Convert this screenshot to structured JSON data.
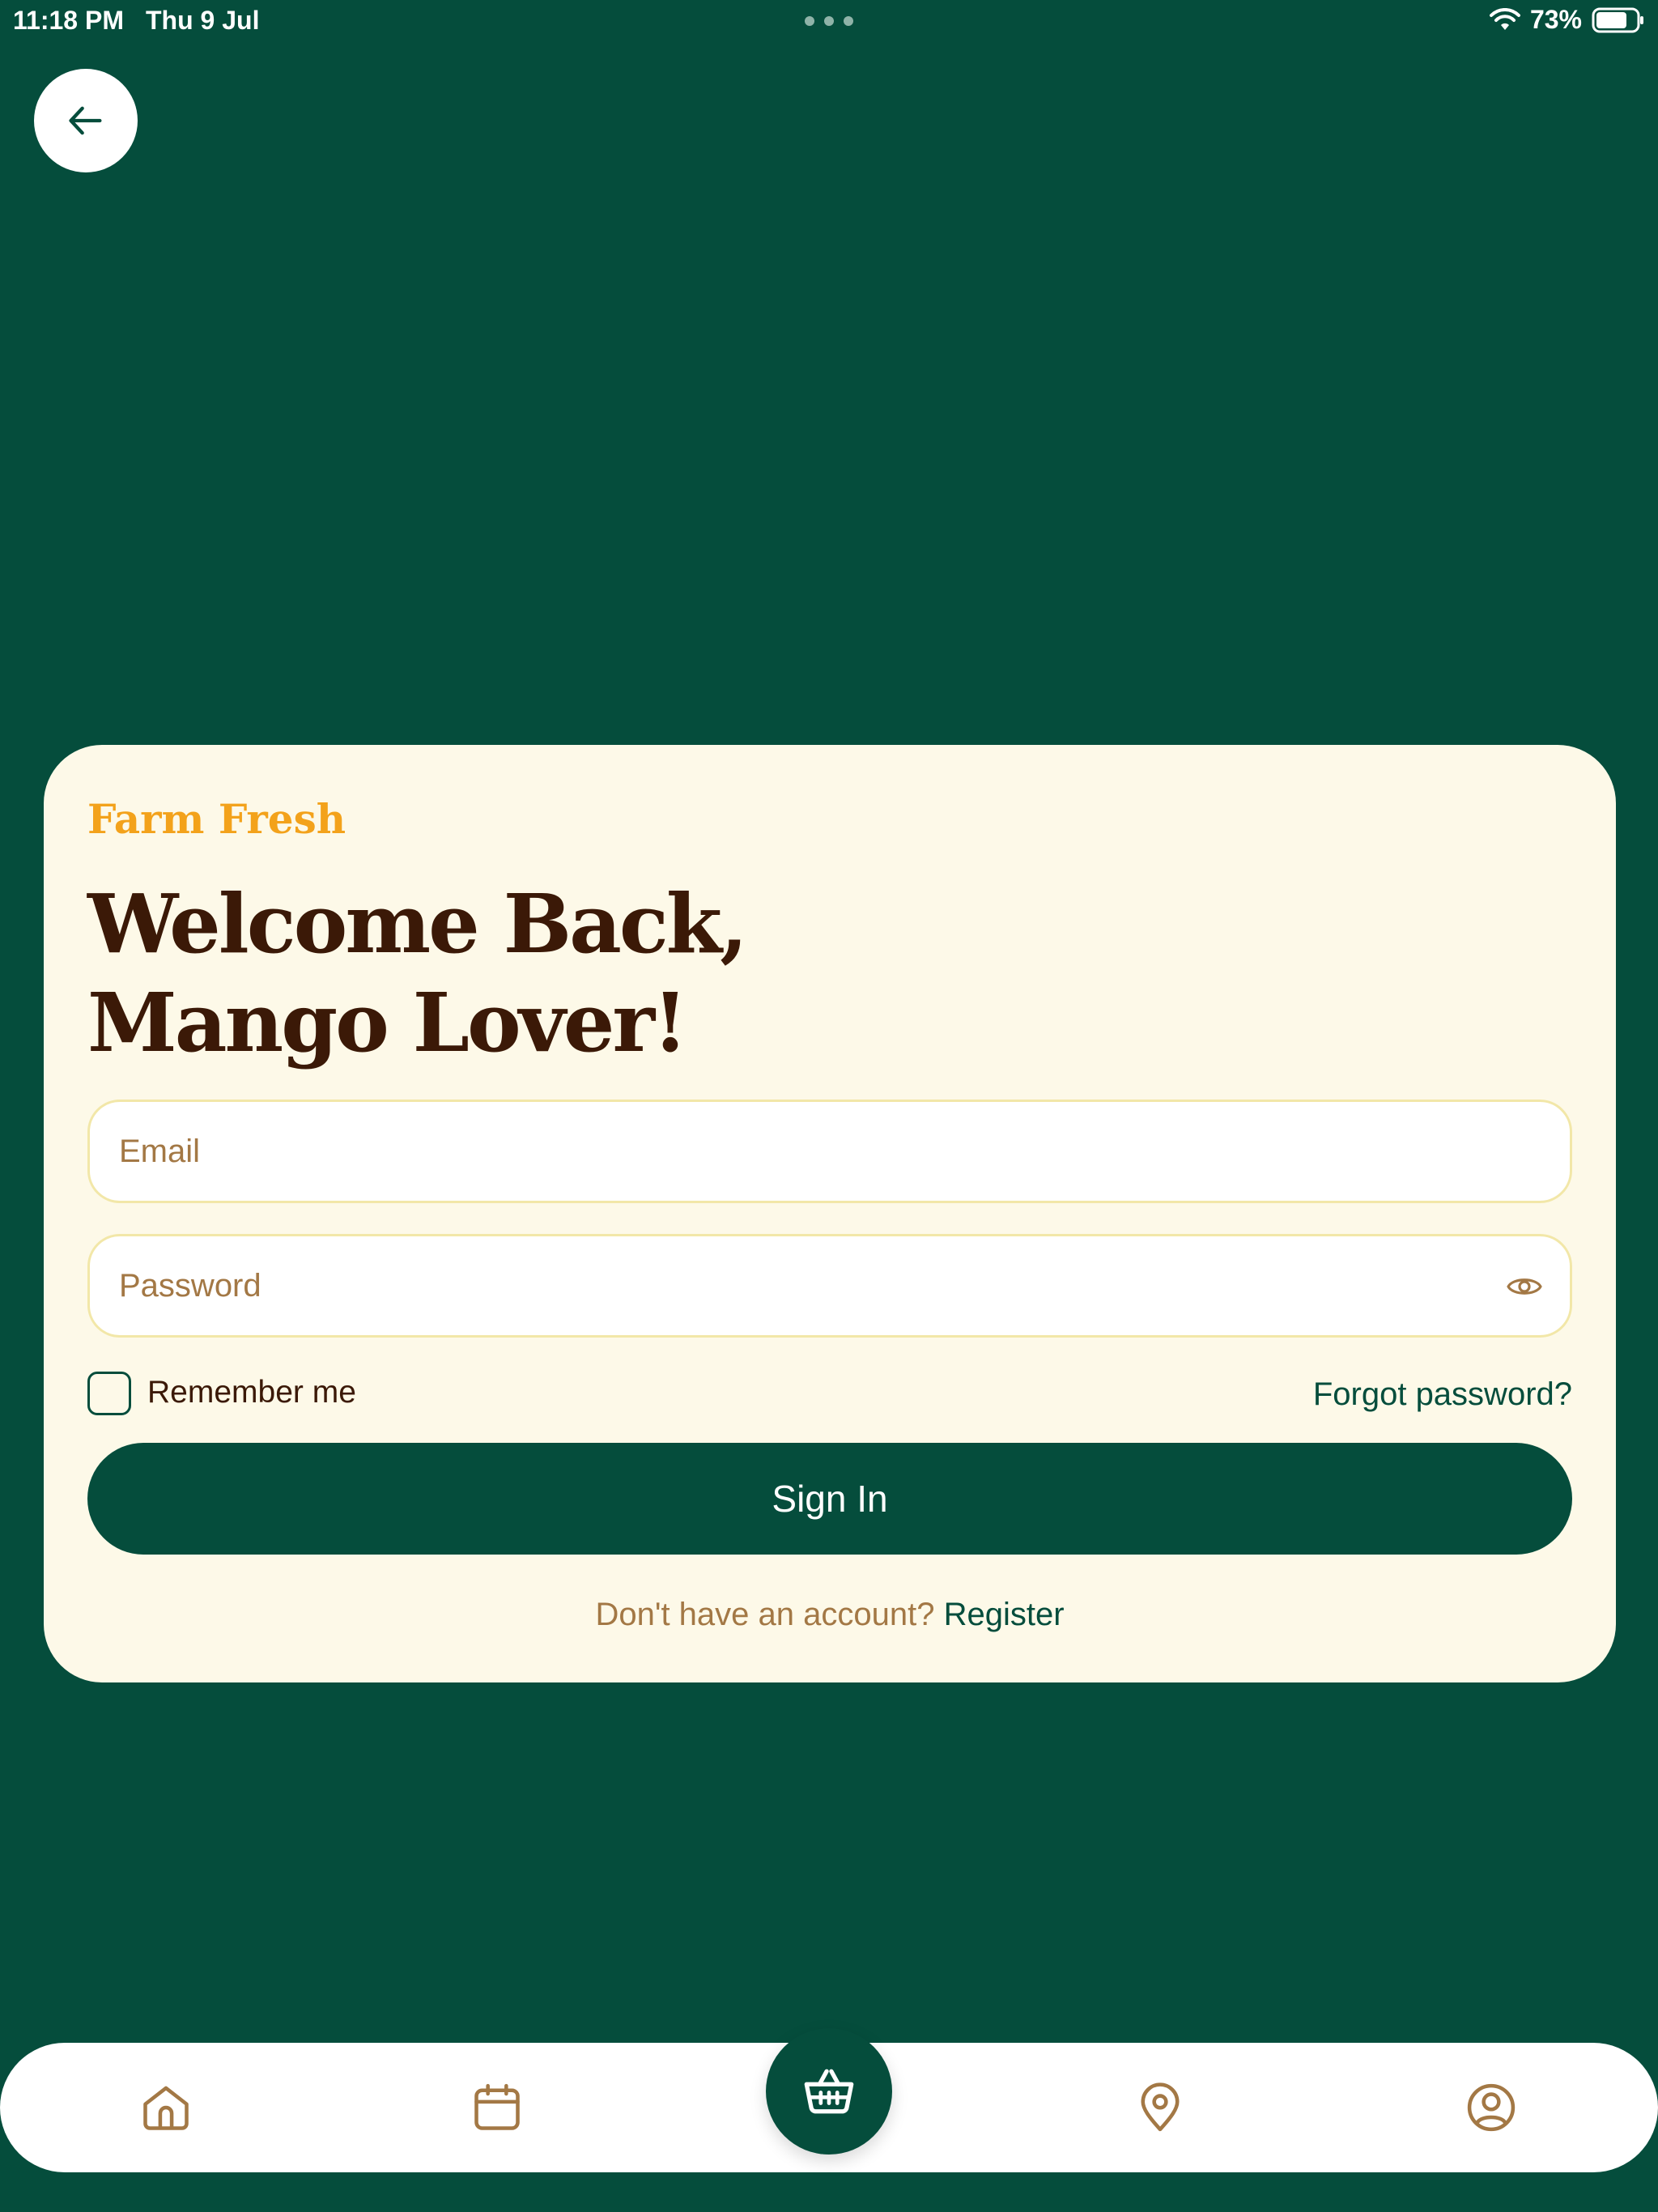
{
  "status_bar": {
    "time": "11:18 PM",
    "date": "Thu 9 Jul",
    "battery": "73%"
  },
  "login_card": {
    "brand": "Farm Fresh",
    "welcome_line1": "Welcome Back,",
    "welcome_line2": "Mango Lover!",
    "email_placeholder": "Email",
    "password_placeholder": "Password",
    "remember_label": "Remember me",
    "forgot_label": "Forgot password?",
    "signin_label": "Sign In",
    "register_prompt": "Don't have an account? ",
    "register_label": "Register"
  },
  "bottom_nav": {
    "items": [
      {
        "icon": "home-icon"
      },
      {
        "icon": "calendar-icon"
      },
      {
        "icon": "basket-icon"
      },
      {
        "icon": "location-pin-icon"
      },
      {
        "icon": "profile-icon"
      }
    ]
  },
  "colors": {
    "background": "#054d3c",
    "card": "#fdf9e8",
    "brand": "#f3a21b",
    "heading": "#3b1907",
    "muted": "#a37845",
    "field_border": "#f2e7a8"
  }
}
